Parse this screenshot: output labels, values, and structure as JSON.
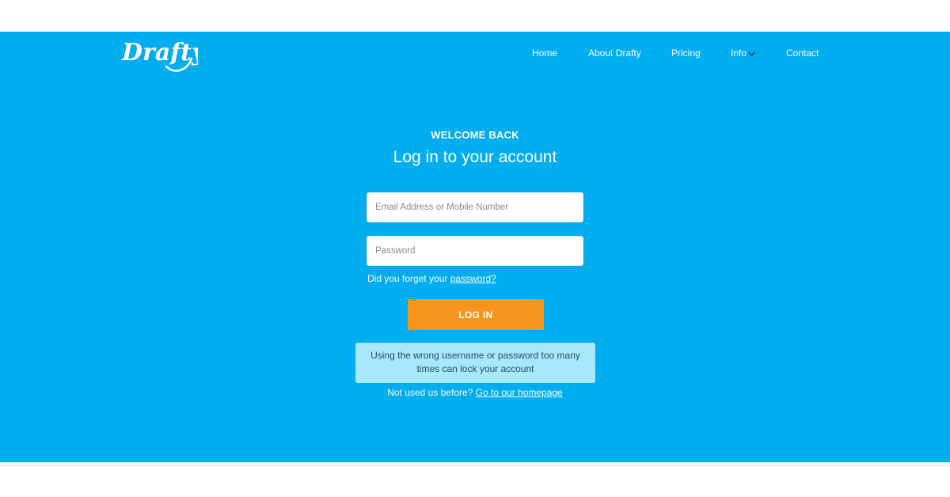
{
  "brand": {
    "logo_text": "Drafty"
  },
  "nav": {
    "items": [
      {
        "label": "Home"
      },
      {
        "label": "About Drafty"
      },
      {
        "label": "Pricing"
      },
      {
        "label": "Info"
      },
      {
        "label": "Contact"
      }
    ]
  },
  "login": {
    "eyebrow": "WELCOME BACK",
    "title": "Log in to your account",
    "email_placeholder": "Email Address or Mobile Number",
    "password_placeholder": "Password",
    "forgot_prefix": "Did you forget your ",
    "forgot_link": "password?",
    "submit_label": "LOG IN",
    "warning": "Using the wrong username or password too many times can lock your account",
    "signup_prefix": "Not used us before? ",
    "signup_link": "Go to our homepage"
  },
  "colors": {
    "hero_background": "#00adef",
    "button": "#f7941d",
    "warning_background": "#a8e8fc"
  }
}
